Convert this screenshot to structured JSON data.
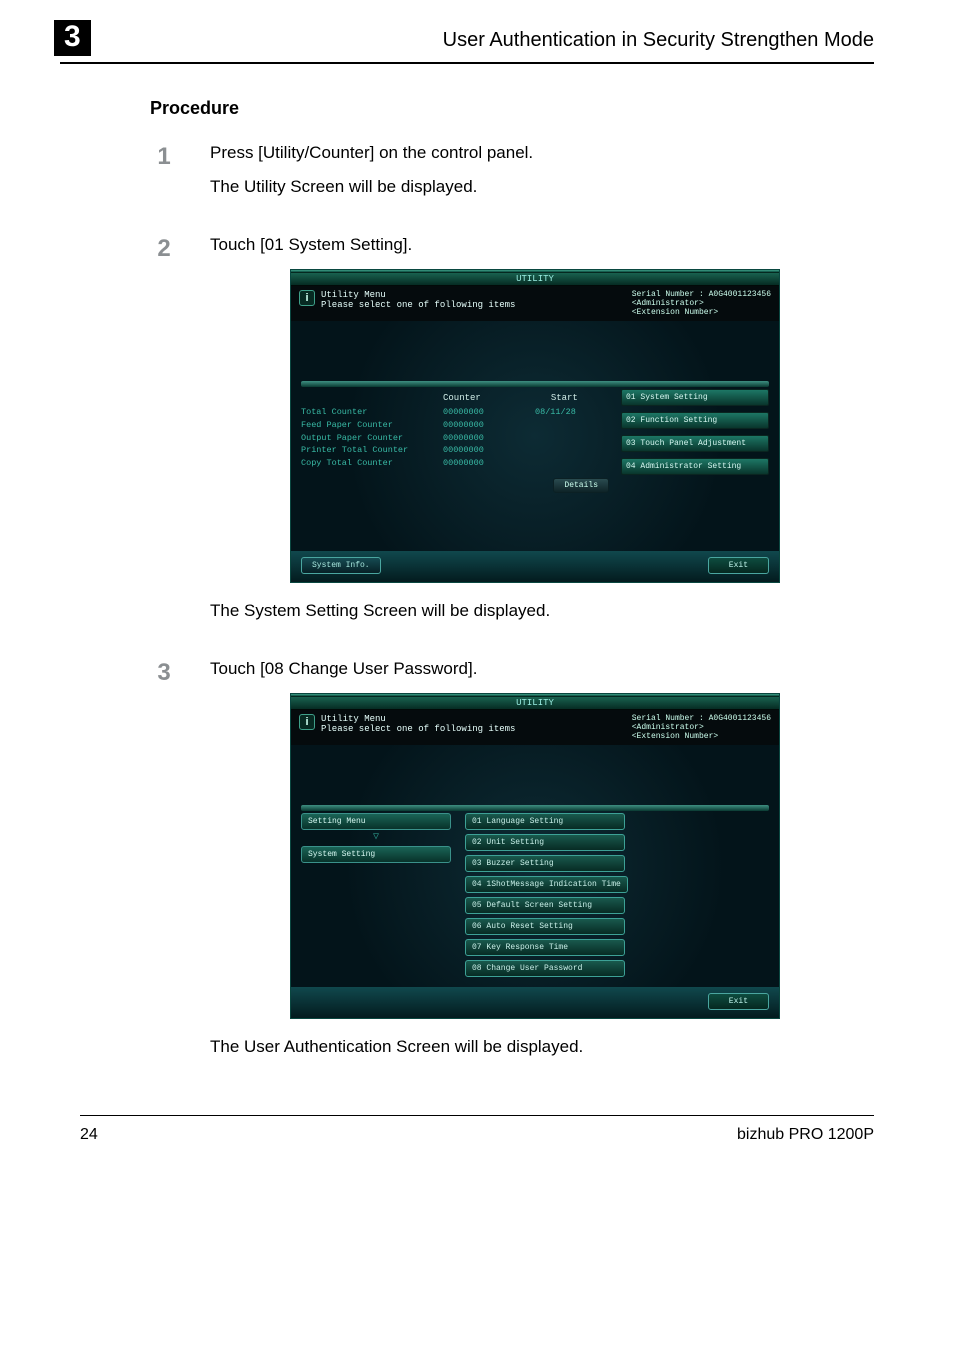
{
  "header": {
    "chapter": "3",
    "title": "User Authentication in Security Strengthen Mode"
  },
  "section": {
    "heading": "Procedure"
  },
  "steps": [
    {
      "num": "1",
      "lines": [
        "Press [Utility/Counter] on the control panel.",
        "The Utility Screen will be displayed."
      ]
    },
    {
      "num": "2",
      "lines": [
        "Touch [01 System Setting]."
      ]
    },
    {
      "num": "3",
      "lines": [
        "Touch [08 Change User Password]."
      ]
    }
  ],
  "screens": {
    "common": {
      "title": "UTILITY",
      "menu_title": "Utility Menu",
      "menu_subtitle": "Please select one of following items",
      "serial_label": "Serial Number",
      "serial_value": ": A0G4001123456",
      "admin_label": "<Administrator>",
      "ext_label": "<Extension Number>",
      "exit": "Exit"
    },
    "s1": {
      "head_counter": "Counter",
      "head_start": "Start",
      "start_value": "08/11/28",
      "rows": [
        {
          "name": "Total Counter",
          "val": "00000000"
        },
        {
          "name": "Feed Paper Counter",
          "val": "00000000"
        },
        {
          "name": "Output Paper Counter",
          "val": "00000000"
        },
        {
          "name": "Printer Total Counter",
          "val": "00000000"
        },
        {
          "name": "Copy Total Counter",
          "val": "00000000"
        }
      ],
      "right": [
        "01 System Setting",
        "02 Function Setting",
        "03 Touch Panel Adjustment",
        "04 Administrator Setting"
      ],
      "details": "Details",
      "system_info": "System Info."
    },
    "s2": {
      "breadcrumb": [
        "Setting Menu",
        "System Setting"
      ],
      "options": [
        "01 Language Setting",
        "02 Unit Setting",
        "03 Buzzer Setting",
        "04 1ShotMessage Indication Time",
        "05 Default Screen Setting",
        "06 Auto Reset Setting",
        "07 Key Response Time",
        "08 Change User Password"
      ]
    }
  },
  "captions": {
    "c1": "The System Setting Screen will be displayed.",
    "c2": "The User Authentication Screen will be displayed."
  },
  "footer": {
    "page": "24",
    "model": "bizhub PRO 1200P"
  }
}
